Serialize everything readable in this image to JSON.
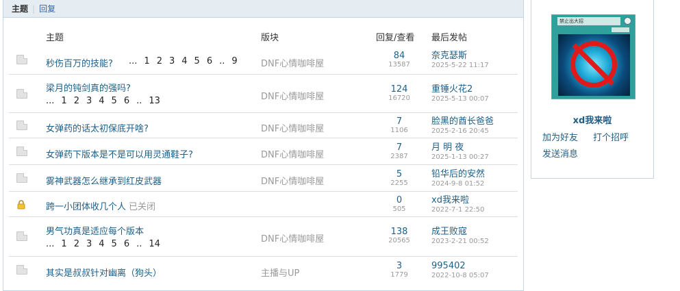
{
  "tabs": {
    "active": "主题",
    "other": "回复"
  },
  "columns": {
    "topic": "主题",
    "forum": "版块",
    "replies_views": "回复/查看",
    "last_post": "最后发帖"
  },
  "threads": [
    {
      "title": "秒伤百万的技能?",
      "pages": [
        "...",
        "1",
        "2",
        "3",
        "4",
        "5",
        "6",
        "..",
        "9"
      ],
      "forum": "DNF心情咖啡屋",
      "replies": "84",
      "views": "13587",
      "last_user": "奈克瑟斯",
      "last_time": "2025-5-22 11:17",
      "icon": "document-icon"
    },
    {
      "title": "梁月的钝剑真的强吗?",
      "pages": [
        "...",
        "1",
        "2",
        "3",
        "4",
        "5",
        "6",
        "..",
        "13"
      ],
      "forum": "DNF心情咖啡屋",
      "replies": "124",
      "views": "16720",
      "last_user": "重锤火花2",
      "last_time": "2025-5-13 00:07",
      "icon": "document-icon"
    },
    {
      "title": "女弹药的话太初保底开啥?",
      "forum": "DNF心情咖啡屋",
      "replies": "7",
      "views": "1106",
      "last_user": "脸黑的酋长爸爸",
      "last_time": "2025-2-16 20:45",
      "icon": "document-icon"
    },
    {
      "title": "女弹药下版本是不是可以用灵通鞋子?",
      "forum": "DNF心情咖啡屋",
      "replies": "7",
      "views": "2387",
      "last_user": "月 明 夜",
      "last_time": "2025-1-13 00:27",
      "icon": "document-icon"
    },
    {
      "title": "雾神武器怎么继承到红皮武器",
      "forum": "DNF心情咖啡屋",
      "replies": "5",
      "views": "2255",
      "last_user": "铅华后的安然",
      "last_time": "2024-9-8 01:52",
      "icon": "document-icon"
    },
    {
      "title": "跨一小团体收几个人",
      "closed": "已关闭",
      "forum": "",
      "replies": "0",
      "views": "505",
      "last_user": "xd我来啦",
      "last_time": "2022-7-1 22:50",
      "icon": "lock-icon"
    },
    {
      "title": "男气功真是适应每个版本",
      "pages": [
        "...",
        "1",
        "2",
        "3",
        "4",
        "5",
        "6",
        "..",
        "14"
      ],
      "forum": "DNF心情咖啡屋",
      "replies": "138",
      "views": "20565",
      "last_user": "成王败寇",
      "last_time": "2023-2-21 00:52",
      "icon": "document-icon"
    },
    {
      "title": "其实是叔叔针对幽离（狗头）",
      "forum": "主播与UP",
      "replies": "3",
      "views": "1779",
      "last_user": "995402",
      "last_time": "2022-10-8 05:07",
      "icon": "document-icon"
    }
  ],
  "profile": {
    "avatar_card_name": "禁止出大招",
    "username": "xd我来啦",
    "add_friend": "加为好友",
    "greet": "打个招呼",
    "message": "发送消息"
  }
}
